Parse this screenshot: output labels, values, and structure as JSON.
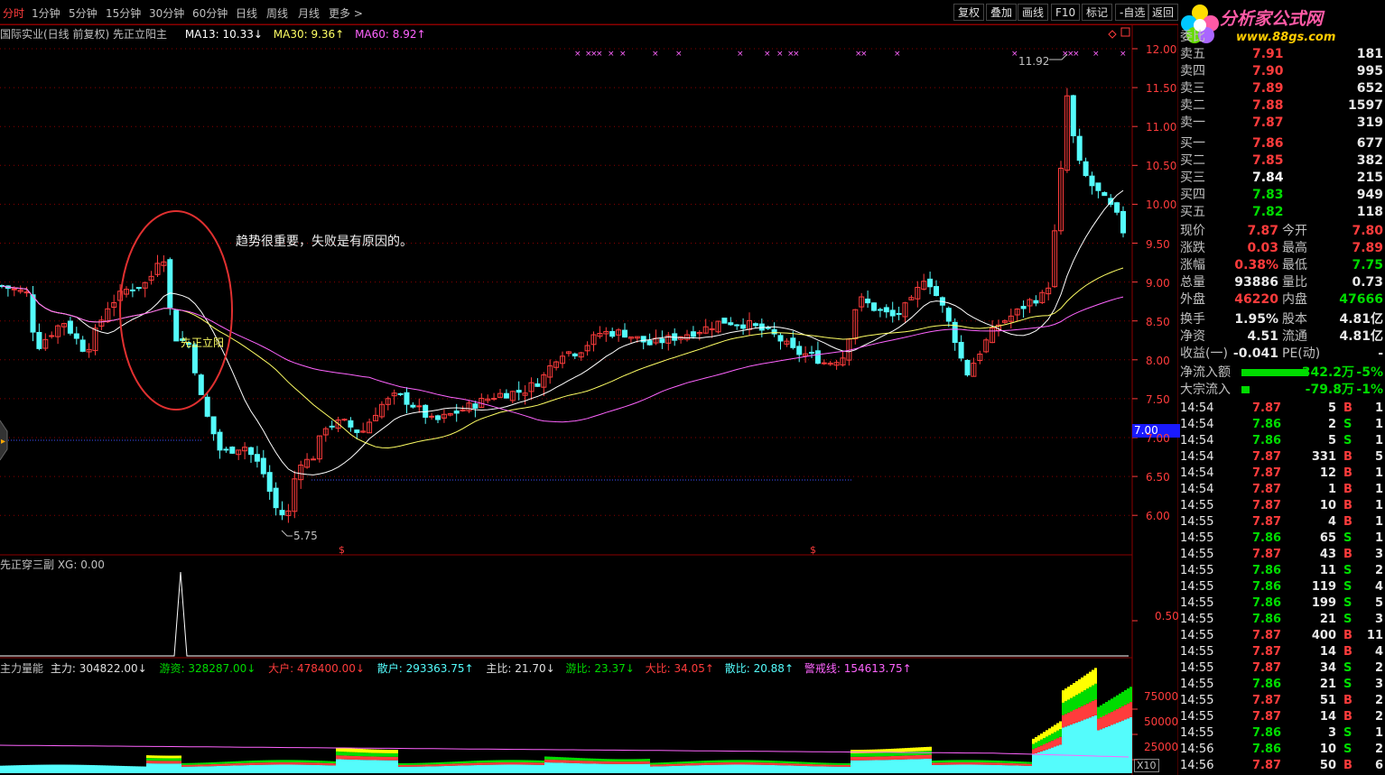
{
  "timeframes": [
    {
      "label": "分时",
      "active": true
    },
    {
      "label": "1分钟"
    },
    {
      "label": "5分钟"
    },
    {
      "label": "15分钟"
    },
    {
      "label": "30分钟"
    },
    {
      "label": "60分钟"
    },
    {
      "label": "日线"
    },
    {
      "label": "周线"
    },
    {
      "label": "月线"
    },
    {
      "label": "更多 >"
    }
  ],
  "toolbar": {
    "fuquan": "复权",
    "diejia": "叠加",
    "huaxian": "画线",
    "f10": "F10",
    "biaoji": "标记",
    "zixuan": "-自选",
    "fanhui": "返回"
  },
  "logo": {
    "brand": "分析家公式网",
    "url": "www.88gs.com"
  },
  "main_indicator": {
    "title": "国际实业(日线 前复权) 先正立阳主",
    "ma13": "MA13: 10.33↓",
    "ma30": "MA30: 9.36↑",
    "ma60": "MA60: 8.92↑"
  },
  "annotation": "趋势很重要，失败是有原因的。",
  "signal_label": "先正立阳",
  "price_labels": {
    "high": "11.92",
    "low": "5.75",
    "current_tag": "7.00"
  },
  "sub1": {
    "title": "先正穿三副 XG: 0.00",
    "axis": "0.50"
  },
  "sub2": {
    "title": "主力量能",
    "zhuli": "主力: 304822.00↓",
    "youzi": "游资: 328287.00↓",
    "dahu": "大户: 478400.00↓",
    "sanhu": "散户: 293363.75↑",
    "zhubi": "主比: 21.70↓",
    "youbi": "游比: 23.37↓",
    "dabi": "大比: 34.05↑",
    "sanbi": "散比: 20.88↑",
    "jingjie": "警戒线: 154613.75↑",
    "axis": [
      "75000",
      "50000",
      "25000"
    ],
    "scale": "X10"
  },
  "price_axis": [
    "12.00",
    "11.50",
    "11.00",
    "10.50",
    "10.00",
    "9.50",
    "9.00",
    "8.50",
    "8.00",
    "7.50",
    "7.00",
    "6.50",
    "6.00"
  ],
  "orderbook": {
    "header": "委比",
    "sells": [
      {
        "label": "卖五",
        "price": "7.91",
        "vol": "181"
      },
      {
        "label": "卖四",
        "price": "7.90",
        "vol": "995"
      },
      {
        "label": "卖三",
        "price": "7.89",
        "vol": "652"
      },
      {
        "label": "卖二",
        "price": "7.88",
        "vol": "1597"
      },
      {
        "label": "卖一",
        "price": "7.87",
        "vol": "319"
      }
    ],
    "buys": [
      {
        "label": "买一",
        "price": "7.86",
        "vol": "677"
      },
      {
        "label": "买二",
        "price": "7.85",
        "vol": "382"
      },
      {
        "label": "买三",
        "price": "7.84",
        "vol": "215"
      },
      {
        "label": "买四",
        "price": "7.83",
        "vol": "949"
      },
      {
        "label": "买五",
        "price": "7.82",
        "vol": "118"
      }
    ]
  },
  "quote": [
    {
      "l1": "现价",
      "v1": "7.87",
      "l2": "今开",
      "v2": "7.80"
    },
    {
      "l1": "涨跌",
      "v1": "0.03",
      "l2": "最高",
      "v2": "7.89"
    },
    {
      "l1": "涨幅",
      "v1": "0.38%",
      "l2": "最低",
      "v2": "7.75"
    },
    {
      "l1": "总量",
      "v1": "93886",
      "l2": "量比",
      "v2": "0.73"
    },
    {
      "l1": "外盘",
      "v1": "46220",
      "l2": "内盘",
      "v2": "47666"
    },
    {
      "l1": "换手",
      "v1": "1.95%",
      "l2": "股本",
      "v2": "4.81亿"
    },
    {
      "l1": "净资",
      "v1": "4.51",
      "l2": "流通",
      "v2": "4.81亿"
    },
    {
      "l1": "收益(一)",
      "v1": "-0.041",
      "l2": "PE(动)",
      "v2": "-"
    }
  ],
  "flows": [
    {
      "label": "净流入额",
      "value": "-342.2万",
      "pct": "-5%"
    },
    {
      "label": "大宗流入",
      "value": "-79.8万",
      "pct": "-1%"
    }
  ],
  "ticks": [
    {
      "t": "14:54",
      "p": "7.87",
      "v": "5",
      "bs": "B",
      "n": "1"
    },
    {
      "t": "14:54",
      "p": "7.86",
      "v": "2",
      "bs": "S",
      "n": "1"
    },
    {
      "t": "14:54",
      "p": "7.86",
      "v": "5",
      "bs": "S",
      "n": "1"
    },
    {
      "t": "14:54",
      "p": "7.87",
      "v": "331",
      "bs": "B",
      "n": "5"
    },
    {
      "t": "14:54",
      "p": "7.87",
      "v": "12",
      "bs": "B",
      "n": "1"
    },
    {
      "t": "14:54",
      "p": "7.87",
      "v": "1",
      "bs": "B",
      "n": "1"
    },
    {
      "t": "14:55",
      "p": "7.87",
      "v": "10",
      "bs": "B",
      "n": "1"
    },
    {
      "t": "14:55",
      "p": "7.87",
      "v": "4",
      "bs": "B",
      "n": "1"
    },
    {
      "t": "14:55",
      "p": "7.86",
      "v": "65",
      "bs": "S",
      "n": "1"
    },
    {
      "t": "14:55",
      "p": "7.87",
      "v": "43",
      "bs": "B",
      "n": "3"
    },
    {
      "t": "14:55",
      "p": "7.86",
      "v": "11",
      "bs": "S",
      "n": "2"
    },
    {
      "t": "14:55",
      "p": "7.86",
      "v": "119",
      "bs": "S",
      "n": "4"
    },
    {
      "t": "14:55",
      "p": "7.86",
      "v": "199",
      "bs": "S",
      "n": "5"
    },
    {
      "t": "14:55",
      "p": "7.86",
      "v": "21",
      "bs": "S",
      "n": "3"
    },
    {
      "t": "14:55",
      "p": "7.87",
      "v": "400",
      "bs": "B",
      "n": "11"
    },
    {
      "t": "14:55",
      "p": "7.87",
      "v": "14",
      "bs": "B",
      "n": "4"
    },
    {
      "t": "14:55",
      "p": "7.87",
      "v": "34",
      "bs": "S",
      "n": "2"
    },
    {
      "t": "14:55",
      "p": "7.86",
      "v": "21",
      "bs": "S",
      "n": "3"
    },
    {
      "t": "14:55",
      "p": "7.87",
      "v": "51",
      "bs": "B",
      "n": "2"
    },
    {
      "t": "14:55",
      "p": "7.87",
      "v": "14",
      "bs": "B",
      "n": "2"
    },
    {
      "t": "14:55",
      "p": "7.86",
      "v": "3",
      "bs": "S",
      "n": "1"
    },
    {
      "t": "14:56",
      "p": "7.86",
      "v": "10",
      "bs": "S",
      "n": "2"
    },
    {
      "t": "14:56",
      "p": "7.87",
      "v": "50",
      "bs": "B",
      "n": "6"
    }
  ],
  "colors": {
    "up": "#ff3c3c",
    "down": "#54fcfc",
    "ma13": "#ffffff",
    "ma30": "#ffff64",
    "ma60": "#ff64ff",
    "green": "#00dc00",
    "yellow": "#ffff00"
  }
}
